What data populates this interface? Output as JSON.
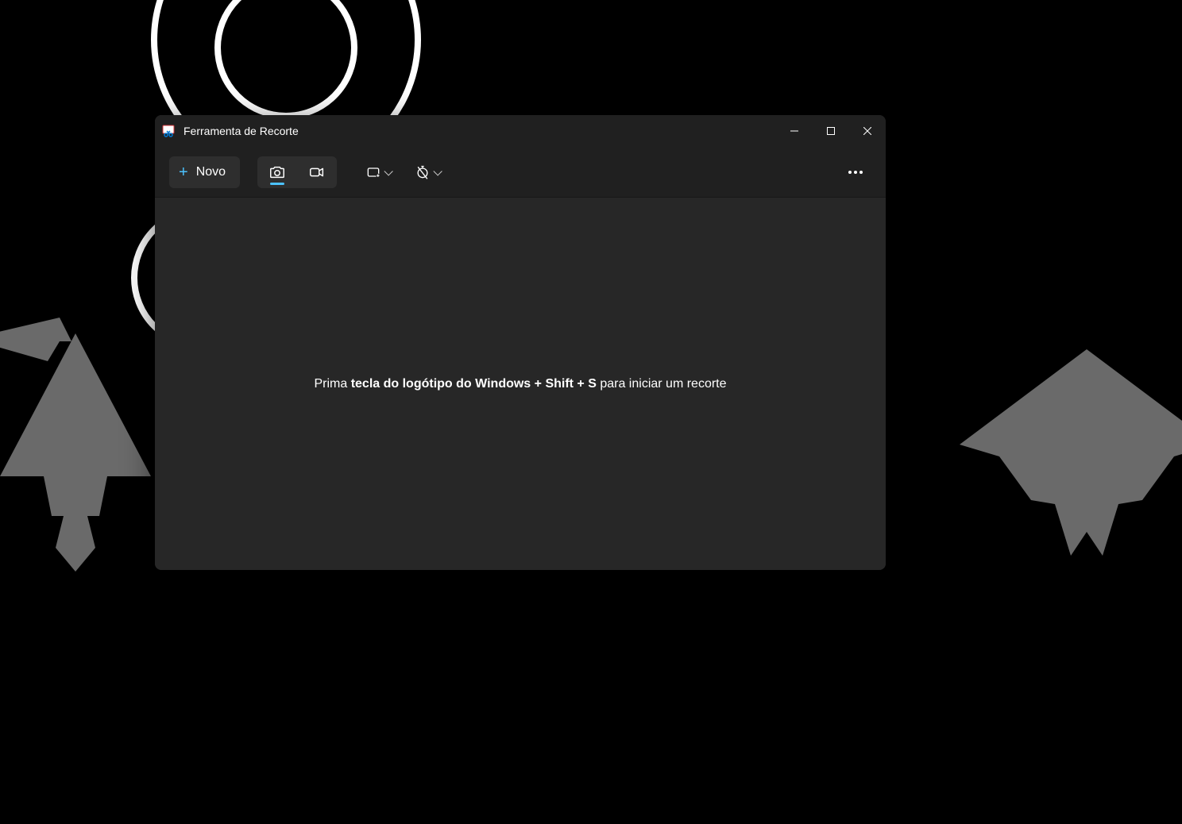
{
  "window": {
    "title": "Ferramenta de Recorte"
  },
  "toolbar": {
    "new_label": "Novo"
  },
  "content": {
    "hint_prefix": "Prima ",
    "hint_shortcut": "tecla do logótipo do Windows + Shift + S",
    "hint_suffix": " para iniciar um recorte"
  }
}
